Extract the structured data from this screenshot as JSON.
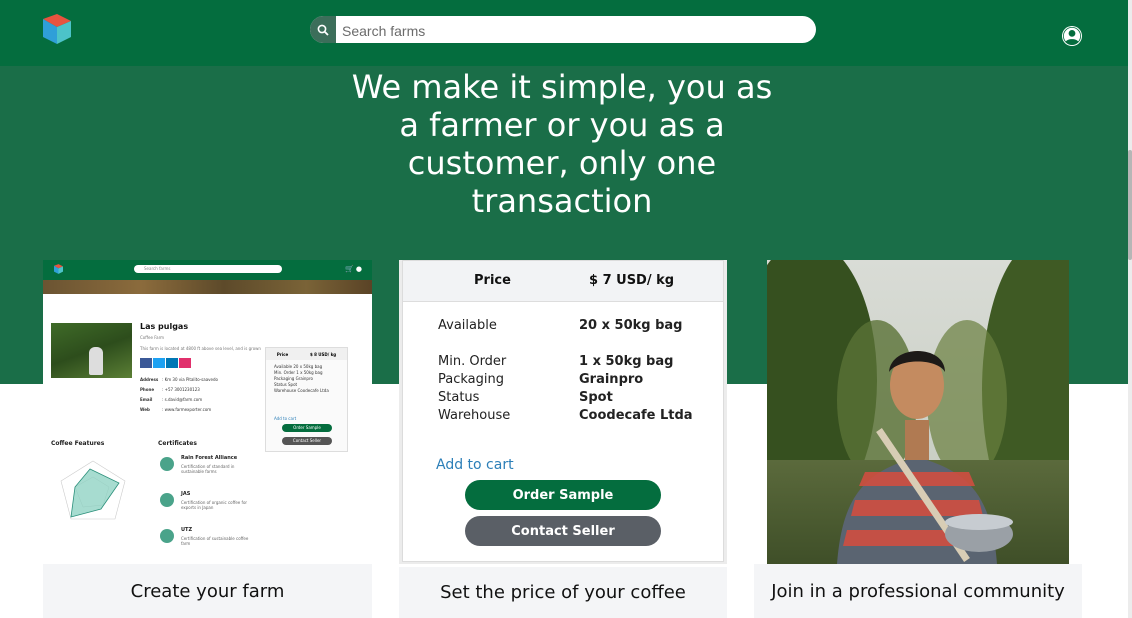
{
  "header": {
    "search_placeholder": "Search farms",
    "logo_icon": "logo-icon",
    "user_icon": "user-account-icon",
    "brand_color": "#046d3e"
  },
  "hero": {
    "headline": "We make it simple, you as a farmer or you as a customer, only one transaction"
  },
  "cards": [
    {
      "caption": "Create your farm",
      "preview": {
        "search_placeholder": "Search farms",
        "farm_name": "Las pulgas",
        "farm_type": "Coffee Farm",
        "description": "This farm is located at 4800 ft above sea level, and is grown",
        "info": [
          {
            "label": "Address",
            "value": ": Km 30 via Pitalito-saavedo"
          },
          {
            "label": "Phone",
            "value": ": +57 3001230123"
          },
          {
            "label": "Email",
            "value": ": s.david@farm.com"
          },
          {
            "label": "Web",
            "value": ": www.farmexporter.com"
          }
        ],
        "price_header": {
          "label": "Price",
          "value": "$ 8 USD/ kg"
        },
        "price_rows": [
          "Available   20 x 50kg bag",
          "Min. Order   1 x 50kg bag",
          "Packaging   Grainpro",
          "Status   Spot",
          "Warehouse   Coodecafe Ltda"
        ],
        "add_to_cart": "Add to cart",
        "order_sample": "Order Sample",
        "contact_seller": "Contact Seller",
        "features_title": "Coffee Features",
        "certificates_title": "Certificates",
        "certificates": [
          {
            "name": "Rain Forest Alliance",
            "desc": "Certification of standard in sustainable farms"
          },
          {
            "name": "JAS",
            "desc": "Certification of organic coffee for exports in Japan"
          },
          {
            "name": "UTZ",
            "desc": "Certification of sustainable coffee farm"
          }
        ]
      }
    },
    {
      "caption": "Set the price of your coffee",
      "price_label": "Price",
      "price_value": "$ 7 USD/ kg",
      "rows": [
        {
          "label": "Available",
          "value": "20    x    50kg bag"
        },
        {
          "label": "Min. Order",
          "value": "1 x 50kg bag"
        },
        {
          "label": "Packaging",
          "value": "Grainpro"
        },
        {
          "label": "Status",
          "value": "Spot"
        },
        {
          "label": "Warehouse",
          "value": "Coodecafe Ltda"
        }
      ],
      "add_to_cart": "Add to cart",
      "order_sample": "Order Sample",
      "contact_seller": "Contact Seller"
    },
    {
      "caption": "Join in a professional community",
      "image": "farmer-holding-basket-photo"
    }
  ]
}
